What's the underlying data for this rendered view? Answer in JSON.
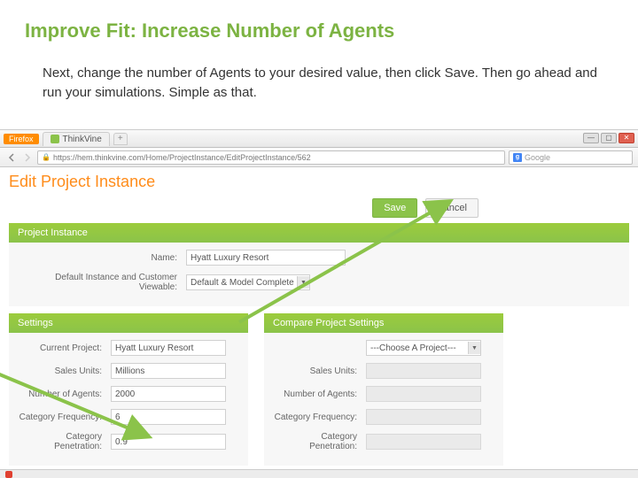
{
  "slide": {
    "title": "Improve Fit: Increase Number of Agents",
    "body": "Next, change the number of Agents to your desired value, then click Save. Then go ahead and run your simulations.  Simple as that."
  },
  "browser": {
    "app_label": "Firefox",
    "tab_title": "ThinkVine",
    "plus": "+",
    "url": "https://hem.thinkvine.com/Home/ProjectInstance/EditProjectInstance/562",
    "search_placeholder": "Google",
    "win": {
      "min": "—",
      "max": "▢",
      "close": "✕"
    }
  },
  "page": {
    "title": "Edit Project Instance",
    "buttons": {
      "save": "Save",
      "cancel": "Cancel"
    },
    "project_instance": {
      "header": "Project Instance",
      "name_label": "Name:",
      "name_value": "Hyatt Luxury Resort",
      "default_label": "Default Instance and Customer Viewable:",
      "default_value": "Default & Model Complete"
    },
    "settings": {
      "header": "Settings",
      "rows": {
        "current_project": {
          "label": "Current Project:",
          "value": "Hyatt Luxury Resort"
        },
        "sales_units": {
          "label": "Sales Units:",
          "value": "Millions"
        },
        "num_agents": {
          "label": "Number of Agents:",
          "value": "2000"
        },
        "cat_freq": {
          "label": "Category Frequency:",
          "value": "6"
        },
        "cat_pen": {
          "label": "Category Penetration:",
          "value": "0.9"
        }
      }
    },
    "compare": {
      "header": "Compare Project Settings",
      "choose": "---Choose A Project---",
      "rows": {
        "sales_units": {
          "label": "Sales Units:"
        },
        "num_agents": {
          "label": "Number of Agents:"
        },
        "cat_freq": {
          "label": "Category Frequency:"
        },
        "cat_pen": {
          "label": "Category Penetration:"
        }
      }
    }
  }
}
